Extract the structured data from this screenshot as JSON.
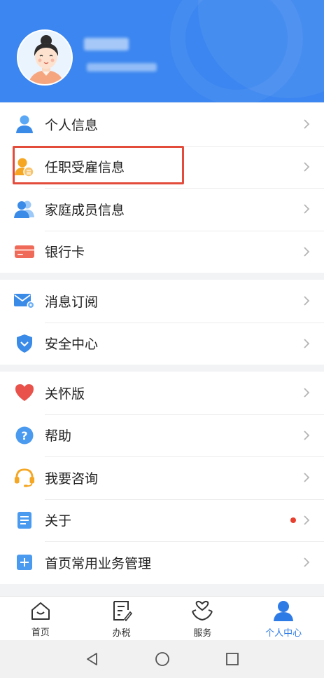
{
  "header": {
    "avatar_alt": "user avatar"
  },
  "group1": [
    {
      "label": "个人信息",
      "icon": "person-icon"
    },
    {
      "label": "任职受雇信息",
      "icon": "employment-icon"
    },
    {
      "label": "家庭成员信息",
      "icon": "family-icon"
    },
    {
      "label": "银行卡",
      "icon": "bank-card-icon"
    }
  ],
  "group2": [
    {
      "label": "消息订阅",
      "icon": "mail-settings-icon"
    },
    {
      "label": "安全中心",
      "icon": "shield-icon"
    }
  ],
  "group3": [
    {
      "label": "关怀版",
      "icon": "heart-icon"
    },
    {
      "label": "帮助",
      "icon": "help-icon"
    },
    {
      "label": "我要咨询",
      "icon": "headset-icon"
    },
    {
      "label": "关于",
      "icon": "document-icon"
    },
    {
      "label": "首页常用业务管理",
      "icon": "plus-icon"
    }
  ],
  "tabs": [
    {
      "label": "首页",
      "icon": "home-icon",
      "active": false
    },
    {
      "label": "办税",
      "icon": "tax-icon",
      "active": false
    },
    {
      "label": "服务",
      "icon": "service-icon",
      "active": false
    },
    {
      "label": "个人中心",
      "icon": "profile-icon",
      "active": true
    }
  ],
  "colors": {
    "header_bg": "#3b86f0",
    "active_tab": "#2f7be6",
    "highlight_border": "#e34b3b",
    "notify_dot": "#e8402f"
  }
}
